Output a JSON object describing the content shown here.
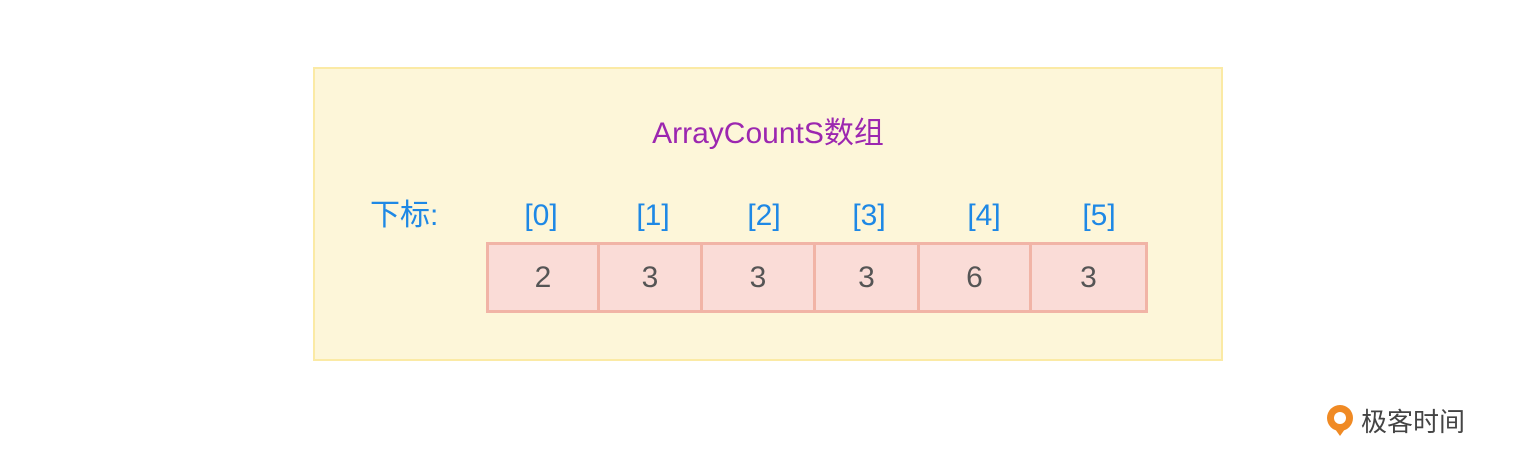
{
  "title": "ArrayCountS数组",
  "index_label": "下标:",
  "indices": [
    "[0]",
    "[1]",
    "[2]",
    "[3]",
    "[4]",
    "[5]"
  ],
  "values": [
    "2",
    "3",
    "3",
    "3",
    "6",
    "3"
  ],
  "brand": {
    "text": "极客时间",
    "icon": "geektime-logo-icon"
  },
  "colors": {
    "panel_bg": "#fdf6d9",
    "panel_border": "#fbeaa5",
    "title": "#9c27b0",
    "index": "#1e88e5",
    "cell_bg": "#fadcd7",
    "cell_border": "#f1b4a6",
    "cell_text": "#555555",
    "brand_accent": "#f08a24"
  }
}
